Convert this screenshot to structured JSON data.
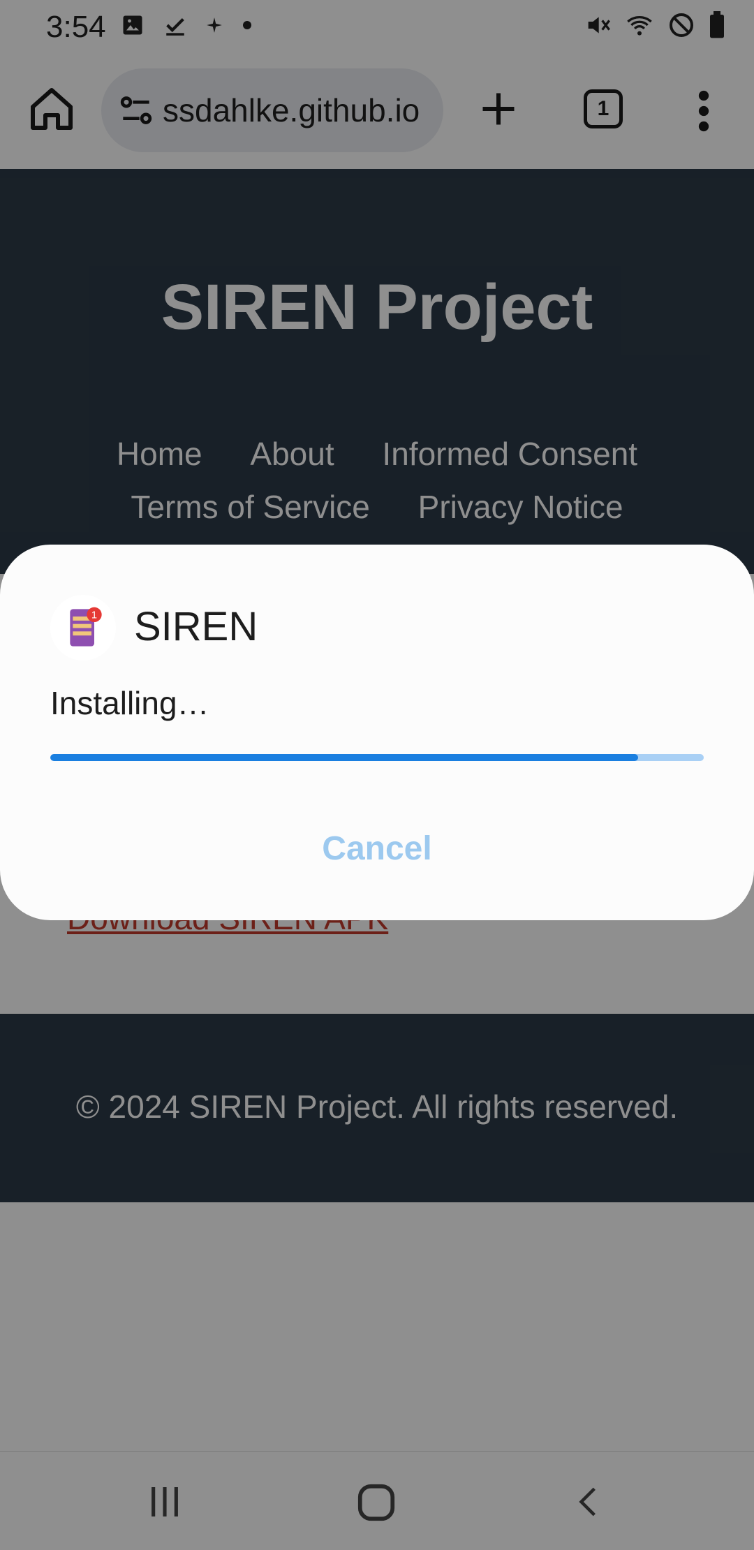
{
  "status_bar": {
    "time": "3:54",
    "icons_left": [
      "image-icon",
      "check-icon",
      "sparkle-icon",
      "dot-icon"
    ],
    "icons_right": [
      "mute-icon",
      "wifi-icon",
      "do-not-disturb-icon",
      "battery-icon"
    ]
  },
  "browser": {
    "url": "ssdahlke.github.io",
    "tab_count": "1"
  },
  "page": {
    "title": "SIREN Project",
    "nav": [
      "Home",
      "About",
      "Informed Consent",
      "Terms of Service",
      "Privacy Notice"
    ],
    "download_link": "Download SIREN APK",
    "footer": "© 2024 SIREN Project. All rights reserved."
  },
  "dialog": {
    "app_name": "SIREN",
    "status": "Installing…",
    "progress": 0.9,
    "cancel_label": "Cancel"
  },
  "colors": {
    "accent": "#1a7fe0",
    "track": "#a9d0f5",
    "header_bg": "#2c3a48",
    "link": "#c0392b"
  }
}
